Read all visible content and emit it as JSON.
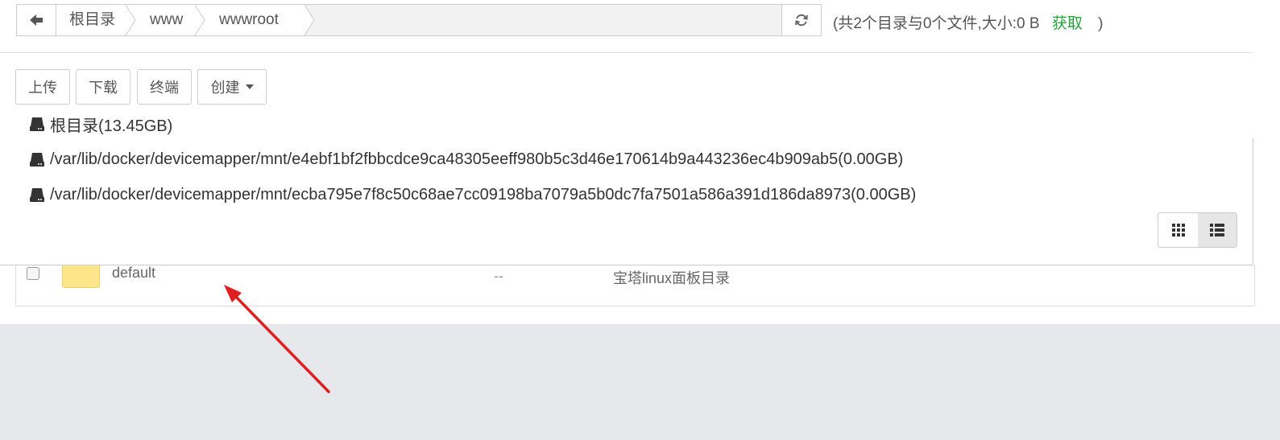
{
  "pathbar": {
    "back_icon": "arrow-left-icon",
    "crumbs": [
      "根目录",
      "www",
      "wwwroot"
    ],
    "refresh_icon": "refresh-icon"
  },
  "summary": {
    "text": "(共2个目录与0个文件,大小:0 B",
    "fetch_label": "获取",
    "close_paren": ")"
  },
  "toolbar": {
    "upload": "上传",
    "download": "下载",
    "terminal": "终端",
    "create": "创建"
  },
  "disks": [
    "根目录(13.45GB)",
    "/var/lib/docker/devicemapper/mnt/e4ebf1bf2fbbcdce9ca48305eeff980b5c3d46e170614b9a443236ec4b909ab5(0.00GB)",
    "/var/lib/docker/devicemapper/mnt/ecba795e7f8c50c68ae7cc09198ba7079a5b0dc7fa7501a586a391d186da8973(0.00GB)"
  ],
  "view": {
    "grid_icon": "grid-view-icon",
    "list_icon": "list-view-icon",
    "active": "list"
  },
  "files": [
    {
      "name": "default",
      "size": "--",
      "note": "宝塔linux面板目录",
      "icon": "folder-icon"
    }
  ],
  "colors": {
    "accent_green": "#20a53a",
    "folder_yellow": "#fde68a",
    "annotation_arrow": "#e02020"
  }
}
